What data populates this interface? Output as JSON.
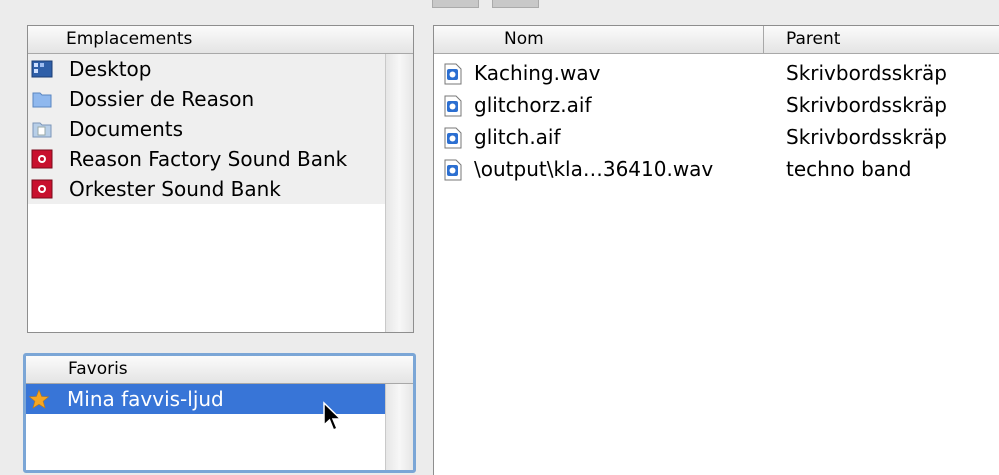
{
  "emplacements": {
    "header": "Emplacements",
    "items": [
      {
        "label": "Desktop",
        "icon": "desktop-icon"
      },
      {
        "label": "Dossier de Reason",
        "icon": "folder-icon"
      },
      {
        "label": "Documents",
        "icon": "documents-folder-icon"
      },
      {
        "label": "Reason Factory Sound Bank",
        "icon": "soundbank-icon"
      },
      {
        "label": "Orkester Sound Bank",
        "icon": "soundbank-icon"
      }
    ]
  },
  "favoris": {
    "header": "Favoris",
    "items": [
      {
        "label": "Mina favvis-ljud",
        "icon": "star-icon",
        "selected": true
      }
    ]
  },
  "files": {
    "columns": {
      "name": "Nom",
      "parent": "Parent"
    },
    "rows": [
      {
        "name": "Kaching.wav",
        "parent": "Skrivbordsskräp"
      },
      {
        "name": "glitchorz.aif",
        "parent": "Skrivbordsskräp"
      },
      {
        "name": "glitch.aif",
        "parent": "Skrivbordsskräp"
      },
      {
        "name": "\\output\\kla…36410.wav",
        "parent": "techno band"
      }
    ]
  },
  "colors": {
    "selection": "#3875d7",
    "focus_ring": "#7ba6d6",
    "soundbank_red": "#c8102e",
    "star": "#f5a623"
  }
}
